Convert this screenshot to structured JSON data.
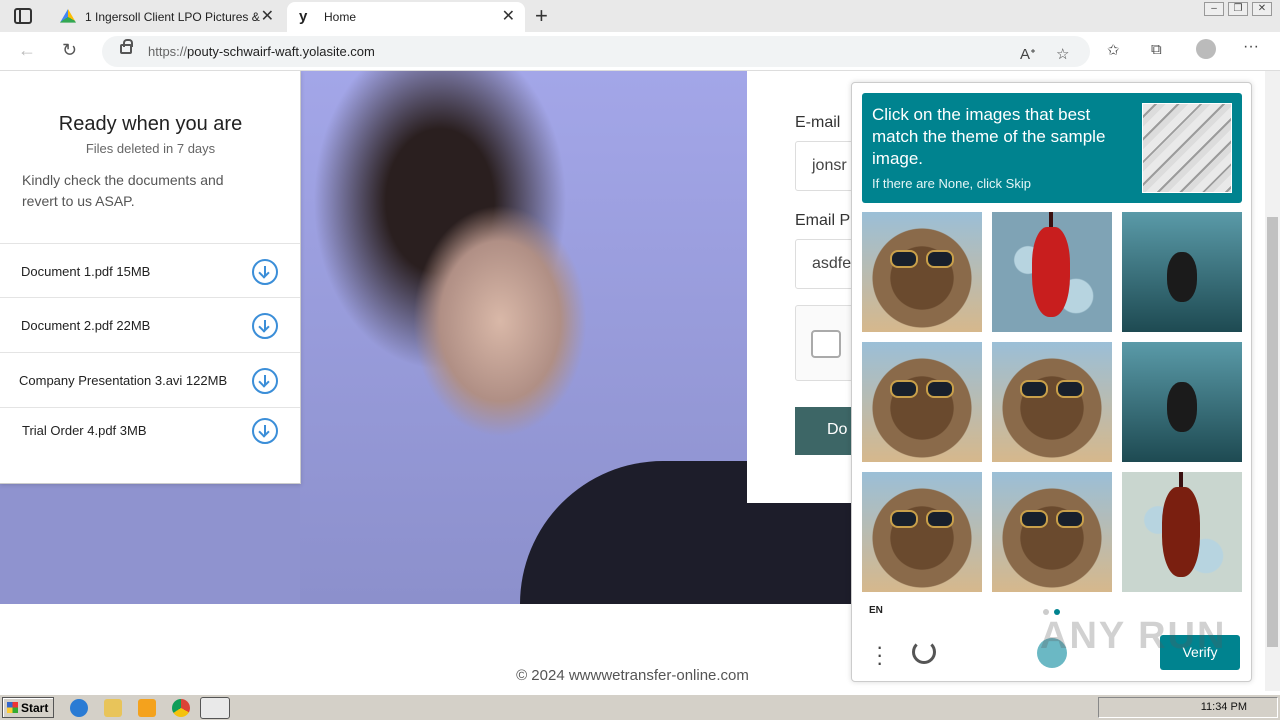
{
  "browser": {
    "tabs": [
      {
        "title": "1 Ingersoll Client LPO Pictures &",
        "active": false
      },
      {
        "title": "Home",
        "active": true
      }
    ],
    "url_prefix": "https://",
    "url_host": "pouty-schwairf-waft.yolasite.com"
  },
  "download_card": {
    "title": "Ready when you are",
    "subtitle": "Files deleted in 7 days",
    "message": "Kindly check the documents and revert to us ASAP.",
    "files": [
      {
        "label": "Document 1.pdf 15MB"
      },
      {
        "label": "Document 2.pdf 22MB"
      },
      {
        "label": "Company Presentation 3.avi 122MB"
      },
      {
        "label": "Trial Order 4.pdf 3MB"
      }
    ]
  },
  "form": {
    "email_label": "E-mail",
    "email_value": "jonsr",
    "password_label": "Email P",
    "password_value": "asdfe",
    "submit_label": "Do"
  },
  "captcha": {
    "prompt": "Click on the images that best match the theme of the sample image.",
    "skip_hint": "If there are None, click Skip",
    "language": "EN",
    "verify_label": "Verify",
    "tiles": [
      "bear",
      "violin",
      "underwater",
      "bear",
      "bear",
      "underwater",
      "bear",
      "bear",
      "violin"
    ],
    "active_page": 2
  },
  "footer": {
    "text": "© 2024 wwwwetransfer-online.com"
  },
  "watermark": "ANY RUN",
  "taskbar": {
    "start_label": "Start",
    "clock": "11:34 PM"
  },
  "colors": {
    "captcha_teal": "#00838f",
    "button_green": "#3d6666",
    "hero_bg": "#8f93cf"
  }
}
